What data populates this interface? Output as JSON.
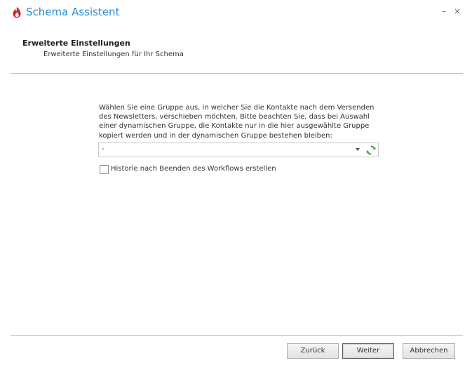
{
  "window": {
    "title": "Schema Assistent",
    "minimize_label": "–",
    "close_label": "×",
    "icon": "flame-logo-icon"
  },
  "header": {
    "title": "Erweiterte Einstellungen",
    "subtitle": "Erweiterte Einstellungen für Ihr Schema"
  },
  "content": {
    "description": "Wählen Sie eine Gruppe aus, in welcher Sie die Kontakte nach dem Versenden des Newsletters, verschieben möchten. Bitte beachten Sie, dass bei Auswahl einer dynamischen Gruppe, die Kontakte nur in die hier ausgewählte Gruppe kopiert werden und in der dynamischen Gruppe bestehen bleiben:",
    "group_select": {
      "value": "-",
      "refresh_icon": "refresh-icon"
    },
    "history_checkbox": {
      "label": "Historie nach Beenden des Workflows erstellen",
      "checked": false
    }
  },
  "buttons": {
    "back": "Zurück",
    "next": "Weiter",
    "cancel": "Abbrechen"
  },
  "colors": {
    "title": "#2a8bd1",
    "logo_red": "#c8262c",
    "refresh_green": "#3ca83c"
  }
}
